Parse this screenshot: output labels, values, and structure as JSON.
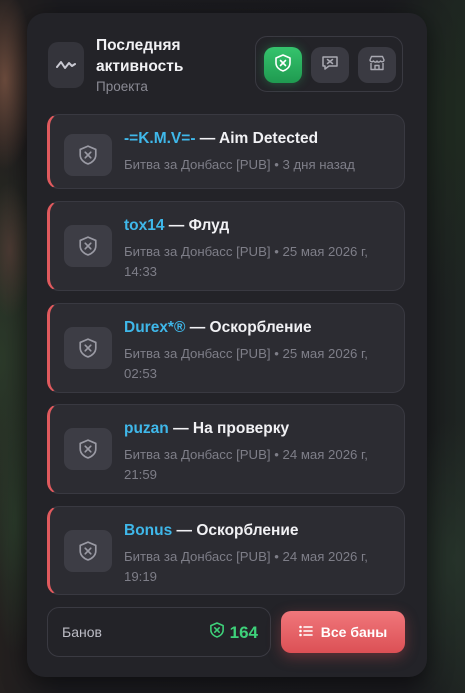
{
  "header": {
    "title": "Последняя активность",
    "subtitle": "Проекта",
    "icon": "activity-wave-icon",
    "tabs": [
      {
        "icon": "shield-ban-icon",
        "active": true
      },
      {
        "icon": "chat-report-icon",
        "active": false
      },
      {
        "icon": "store-icon",
        "active": false
      }
    ]
  },
  "bans": [
    {
      "user": "-=K.M.V=-",
      "separator": " — ",
      "reason": "Aim Detected",
      "meta": "Битва за Донбасс [PUB] • 3 дня назад"
    },
    {
      "user": "tox14",
      "separator": " — ",
      "reason": "Флуд",
      "meta": "Битва за Донбасс [PUB] • 25 мая 2026 г, 14:33"
    },
    {
      "user": "Durex*®",
      "separator": " — ",
      "reason": "Оскорбление",
      "meta": "Битва за Донбасс [PUB] • 25 мая 2026 г, 02:53"
    },
    {
      "user": "puzan",
      "separator": " — ",
      "reason": "На проверку",
      "meta": "Битва за Донбасс [PUB] • 24 мая 2026 г, 21:59"
    },
    {
      "user": "Bonus",
      "separator": " — ",
      "reason": "Оскорбление",
      "meta": "Битва за Донбасс [PUB] • 24 мая 2026 г, 19:19"
    }
  ],
  "footer": {
    "label": "Банов",
    "count": "164",
    "button_label": "Все баны"
  },
  "colors": {
    "accent_green": "#3ed17a",
    "accent_red": "#e05a5e",
    "username_blue": "#3fb8ea"
  }
}
